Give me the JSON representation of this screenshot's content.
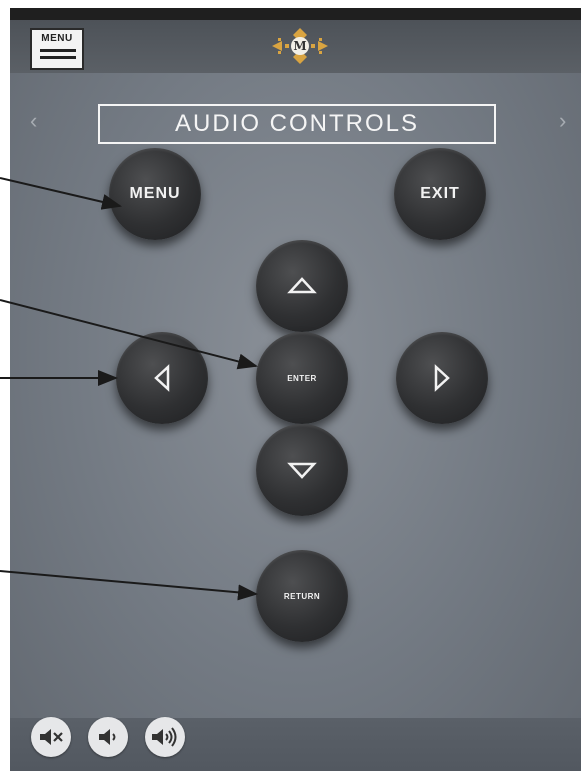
{
  "header": {
    "menu_label": "MENU"
  },
  "title": "AUDIO CONTROLS",
  "nav": {
    "prev_glyph": "‹",
    "next_glyph": "›"
  },
  "buttons": {
    "menu": "MENU",
    "exit": "EXIT",
    "enter": "ENTER",
    "return": "RETURN"
  },
  "icons": {
    "up": "triangle-up-icon",
    "down": "triangle-down-icon",
    "left": "triangle-left-icon",
    "right": "triangle-right-icon",
    "mute": "volume-mute-icon",
    "volume_down": "volume-down-icon",
    "volume_up": "volume-up-icon",
    "logo": "brand-logo-icon"
  },
  "colors": {
    "panel": "#737a83",
    "button": "#2f3032",
    "logo_gold": "#d9a441"
  }
}
